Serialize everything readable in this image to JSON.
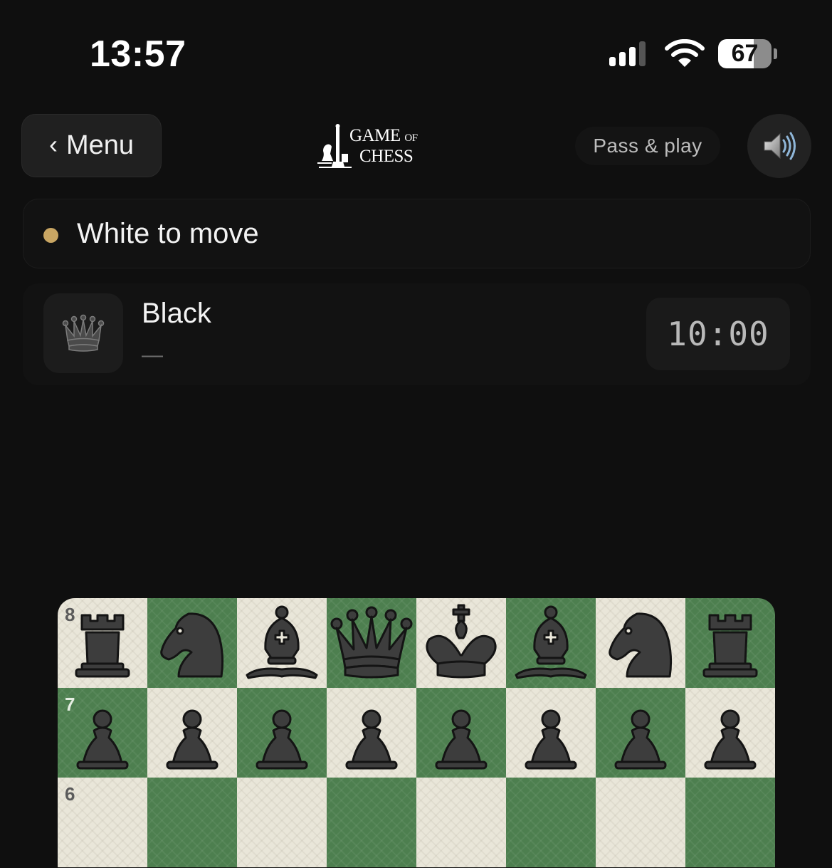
{
  "status_bar": {
    "time": "13:57",
    "battery_level": "67",
    "signal_bars_active": 3,
    "icons": [
      "cellular-signal-icon",
      "wifi-icon",
      "battery-icon"
    ]
  },
  "header": {
    "back_label": "Menu",
    "logo": {
      "line1": "GAME",
      "of": "OF",
      "line2": "CHESS"
    },
    "mode_label": "Pass & play",
    "sound_icon": "speaker-icon"
  },
  "turn": {
    "text": "White to move",
    "dot_color": "#c9a663"
  },
  "opponent": {
    "name": "Black",
    "sub": "—",
    "clock": "10:00",
    "avatar_icon": "black-queen-icon"
  },
  "board": {
    "light_color": "#e9e6d9",
    "dark_color": "#4d7f4f",
    "visible_ranks": [
      {
        "rank": "8",
        "pieces": [
          "rook",
          "knight",
          "bishop",
          "queen",
          "king",
          "bishop",
          "knight",
          "rook"
        ]
      },
      {
        "rank": "7",
        "pieces": [
          "pawn",
          "pawn",
          "pawn",
          "pawn",
          "pawn",
          "pawn",
          "pawn",
          "pawn"
        ]
      },
      {
        "rank": "6",
        "pieces": [
          "",
          "",
          "",
          "",
          "",
          "",
          "",
          ""
        ]
      }
    ],
    "piece_color": "black"
  }
}
